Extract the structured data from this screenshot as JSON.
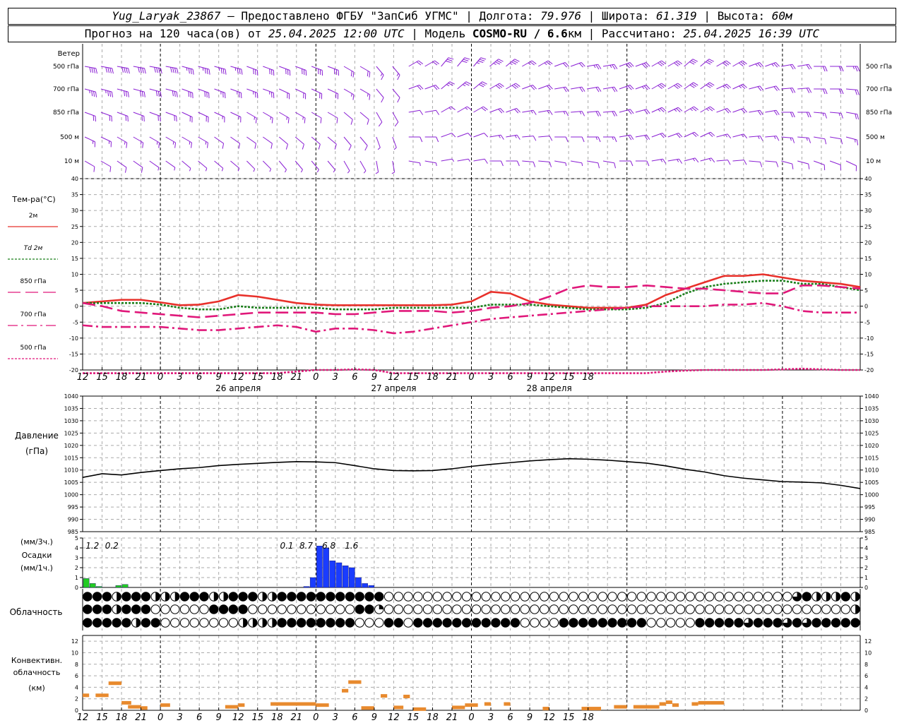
{
  "header": {
    "station": "Yug_Laryak_23867",
    "provider": "— Предоставлено ФГБУ \"ЗапСиб УГМС\"",
    "lon_label": "| Долгота:",
    "lon": "79.976",
    "lat_label": "| Широта:",
    "lat": "61.319",
    "alt_label": "| Высота:",
    "alt": "60м",
    "fc_prefix": "Прогноз на 120 часа(ов) от",
    "fc_time": "25.04.2025 12:00 UTC",
    "model_label": "| Модель",
    "model": "COSMO-RU / 6.6",
    "model_unit": "км",
    "calc_label": "| Рассчитано:",
    "calc_time": "25.04.2025 16:39 UTC"
  },
  "chart_data": [
    {
      "type": "wind-barbs",
      "title": "Ветер",
      "levels": [
        "500 гПа",
        "700 гПа",
        "850 гПа",
        "500 м",
        "10 м"
      ],
      "speeds_ms": [
        [
          20,
          20,
          19,
          18,
          17,
          16,
          15,
          14,
          10,
          7,
          10,
          15,
          18,
          18,
          12,
          10,
          12,
          14,
          15,
          16,
          14,
          12,
          11,
          10,
          12
        ],
        [
          17,
          16,
          15,
          14,
          13,
          12,
          11,
          10,
          8,
          6,
          9,
          12,
          14,
          14,
          10,
          9,
          11,
          13,
          14,
          15,
          13,
          11,
          10,
          9,
          11
        ],
        [
          11,
          10,
          9,
          9,
          8,
          8,
          7,
          6,
          5,
          4,
          6,
          8,
          9,
          10,
          8,
          7,
          9,
          11,
          12,
          12,
          10,
          9,
          9,
          8,
          10
        ],
        [
          8,
          8,
          7,
          7,
          6,
          6,
          5,
          5,
          4,
          3,
          4,
          5,
          6,
          7,
          6,
          5,
          7,
          9,
          10,
          10,
          8,
          7,
          7,
          6,
          8
        ],
        [
          4,
          4,
          3,
          3,
          3,
          3,
          2,
          2,
          2,
          2,
          3,
          3,
          4,
          4,
          4,
          3,
          5,
          6,
          7,
          7,
          6,
          5,
          5,
          4,
          5
        ]
      ],
      "directions_deg": [
        [
          280,
          280,
          280,
          285,
          285,
          290,
          290,
          290,
          300,
          320,
          240,
          220,
          220,
          230,
          240,
          250,
          260,
          250,
          240,
          230,
          240,
          250,
          260,
          270,
          270
        ],
        [
          285,
          285,
          285,
          290,
          290,
          290,
          295,
          295,
          300,
          320,
          250,
          230,
          230,
          240,
          250,
          260,
          260,
          250,
          240,
          235,
          245,
          255,
          265,
          270,
          275
        ],
        [
          290,
          290,
          290,
          295,
          295,
          300,
          300,
          300,
          310,
          330,
          260,
          240,
          240,
          250,
          260,
          265,
          265,
          255,
          245,
          240,
          250,
          260,
          270,
          275,
          280
        ],
        [
          295,
          300,
          300,
          300,
          305,
          305,
          310,
          310,
          320,
          340,
          270,
          250,
          250,
          260,
          265,
          270,
          270,
          260,
          250,
          245,
          255,
          265,
          275,
          280,
          285
        ],
        [
          300,
          305,
          305,
          310,
          310,
          315,
          320,
          320,
          330,
          350,
          280,
          260,
          260,
          270,
          275,
          280,
          280,
          270,
          260,
          255,
          265,
          275,
          285,
          290,
          295
        ]
      ]
    },
    {
      "type": "line",
      "ylabel": "Тем-ра(°C)",
      "ylim": [
        -20,
        40
      ],
      "yticks": [
        "40",
        "35",
        "30",
        "25",
        "20",
        "15",
        "10",
        "5",
        "0",
        "-5",
        "-10",
        "-15",
        "-20"
      ],
      "x_hours": [
        0,
        3,
        6,
        9,
        12,
        15,
        18,
        21,
        24,
        27,
        30,
        33,
        36,
        39,
        42,
        45,
        48,
        51,
        54,
        57,
        60,
        63,
        66,
        69,
        72,
        75,
        78,
        81,
        84,
        87,
        90,
        93,
        96,
        99,
        102,
        105,
        108,
        111,
        114,
        117,
        120
      ],
      "series": [
        {
          "name": "2м",
          "color": "#e8302a",
          "dash": "solid",
          "values": [
            1,
            1.5,
            2,
            2,
            1.2,
            0.3,
            0.5,
            1.5,
            3.5,
            3,
            2,
            1,
            0.5,
            0.3,
            0.3,
            0.3,
            0.3,
            0.3,
            0.3,
            0.5,
            1.5,
            4.5,
            4,
            1.5,
            0.5,
            0,
            -0.5,
            -0.5,
            -0.5,
            0.5,
            3.5,
            5.5,
            7.5,
            9.5,
            9.5,
            10,
            9,
            8,
            7.5,
            7,
            6
          ]
        },
        {
          "name": "Td 2м",
          "color": "#1a7f1a",
          "dash": "dotted",
          "values": [
            1,
            1,
            1,
            1,
            0.5,
            -0.5,
            -1,
            -1,
            0,
            -0.5,
            -0.5,
            -0.5,
            -0.5,
            -1,
            -1,
            -1,
            -0.5,
            -0.5,
            -0.5,
            -0.5,
            -0.5,
            0.5,
            0.5,
            0.5,
            0,
            -0.5,
            -1,
            -1,
            -1,
            -0.5,
            1,
            4,
            6,
            7,
            7.5,
            8,
            8,
            7,
            7,
            6,
            5
          ]
        },
        {
          "name": "850 гПа",
          "color": "#e0187a",
          "dash": "longdash",
          "values": [
            1,
            0,
            -1.5,
            -2,
            -2.5,
            -3,
            -3.5,
            -3,
            -2.5,
            -2,
            -2,
            -2,
            -2,
            -2.5,
            -2.5,
            -2,
            -1.5,
            -1.5,
            -1.5,
            -2,
            -1.5,
            -0.5,
            0,
            1,
            3,
            5.5,
            6.5,
            6,
            6,
            6.5,
            6,
            5.5,
            5.5,
            5,
            4.5,
            4,
            4,
            6.5,
            6.5,
            6,
            5.5
          ]
        },
        {
          "name": "700 гПа",
          "color": "#e0187a",
          "dash": "dashdot",
          "values": [
            -6,
            -6.5,
            -6.5,
            -6.5,
            -6.5,
            -7,
            -7.5,
            -7.5,
            -7,
            -6.5,
            -6,
            -6.5,
            -8,
            -7,
            -7,
            -7.5,
            -8.5,
            -8,
            -7,
            -6,
            -5,
            -4,
            -3.5,
            -3,
            -2.5,
            -2,
            -1.5,
            -1,
            -0.5,
            0,
            0,
            0,
            0,
            0.5,
            0.5,
            1,
            0,
            -1.5,
            -2,
            -2,
            -2
          ]
        },
        {
          "name": "500 гПа",
          "color": "#e0187a",
          "dash": "dotted",
          "values": [
            -21,
            -21,
            -21,
            -21,
            -21,
            -21,
            -21,
            -21,
            -21,
            -21,
            -21,
            -20.5,
            -20,
            -20,
            -19.8,
            -20,
            -21,
            -21,
            -21,
            -21,
            -21,
            -21,
            -21,
            -21,
            -21,
            -21,
            -21,
            -21,
            -21,
            -21,
            -20.5,
            -20.2,
            -20,
            -20,
            -20,
            -20,
            -19.8,
            -19.6,
            -19.8,
            -20,
            -20
          ]
        }
      ]
    },
    {
      "type": "line",
      "ylabel": "Давление",
      "yunit": "(гПа)",
      "ylim": [
        985,
        1040
      ],
      "yticks": [
        "1040",
        "1035",
        "1030",
        "1025",
        "1020",
        "1015",
        "1010",
        "1005",
        "1000",
        "995",
        "990",
        "985"
      ],
      "x_hours": [
        0,
        3,
        6,
        9,
        12,
        15,
        18,
        21,
        24,
        27,
        30,
        33,
        36,
        39,
        42,
        45,
        48,
        51,
        54,
        57,
        60,
        63,
        66,
        69,
        72,
        75,
        78,
        81,
        84,
        87,
        90,
        93,
        96,
        99,
        102,
        105,
        108,
        111,
        114,
        117,
        120
      ],
      "values": [
        1007,
        1008.5,
        1008,
        1009,
        1009.8,
        1010.5,
        1011,
        1011.8,
        1012.3,
        1012.7,
        1013.1,
        1013.4,
        1013.3,
        1013,
        1011.8,
        1010.5,
        1009.8,
        1009.7,
        1009.8,
        1010.5,
        1011.5,
        1012.3,
        1013,
        1013.7,
        1014.2,
        1014.6,
        1014.4,
        1014,
        1013.4,
        1012.8,
        1011.7,
        1010.3,
        1009.2,
        1007.7,
        1006.7,
        1006,
        1005.3,
        1005.1,
        1004.8,
        1003.8,
        1002.5
      ],
      "color": "#000000"
    },
    {
      "type": "bar",
      "ylabel": "Осадки",
      "yunit_top": "(мм/3ч.)",
      "yunit_bottom": "(мм/1ч.)",
      "ylim": [
        0,
        5
      ],
      "yticks": [
        "5",
        "4",
        "3",
        "2",
        "1",
        "0"
      ],
      "annotations": [
        "1.2",
        "0.2",
        "0.1",
        "8.7",
        "6.8",
        "1.6"
      ],
      "series": [
        {
          "name": "liquid",
          "color": "#22cc22",
          "hours": [
            0,
            1,
            2,
            3,
            4,
            5,
            6
          ],
          "values": [
            0.9,
            0.4,
            0.1,
            0,
            0,
            0.2,
            0.3
          ]
        },
        {
          "name": "snow",
          "color": "#1a3cff",
          "hours": [
            34,
            35,
            36,
            37,
            38,
            39,
            40,
            41,
            42,
            43,
            44
          ],
          "values": [
            0.1,
            1,
            4.2,
            4,
            2.7,
            2.5,
            2.2,
            2,
            1,
            0.4,
            0.2
          ]
        }
      ]
    },
    {
      "type": "symbols",
      "ylabel": "Облачность",
      "rows": [
        "ffpfhhffffhhhhfftffehhfffffhhhfffffffffffffffffeeeeeeeeeeeeeeeeeeeeeeeeeeeeeeepeeeeeeeeeeeeeeeeeeeeeeeeeeeeeeeeeepfehhhhffhp",
        "ffqfheffffeeeeeeeeefffffffeeeeeeeeeeeeeeeeefffqeeeeeeeeeeeeeeeeeeeeeeeeeeeeeeeeeeeeeeeeeeeeeeeeeeeeeeeeeeeeeeeeeeeeeeeeeeeehe",
        "fffffffhffffeeeeeeeeeeeehhhhhhhffffhfffffffeeeeepffpefffffffffffffffffeeeeeeeffffffffffffffeeeeeeeeffffffffpffffffpffpfffffffff"
      ]
    },
    {
      "type": "bar",
      "ylabel": "Конвективн.",
      "ylabel2": "облачность",
      "yunit": "(км)",
      "ylim": [
        0,
        13
      ],
      "yticks": [
        "12",
        "10",
        "8",
        "6",
        "4",
        "2",
        "0"
      ],
      "color": "#e88a2e",
      "segments": [
        {
          "h0": 0,
          "h1": 1,
          "v": 2.6
        },
        {
          "h0": 2,
          "h1": 4,
          "v": 2.6
        },
        {
          "h0": 4,
          "h1": 6,
          "v": 4.7
        },
        {
          "h0": 6,
          "h1": 7.5,
          "v": 1.3
        },
        {
          "h0": 7,
          "h1": 9,
          "v": 0.6
        },
        {
          "h0": 9,
          "h1": 10,
          "v": 0.4
        },
        {
          "h0": 12,
          "h1": 13.5,
          "v": 0.9
        },
        {
          "h0": 22,
          "h1": 24,
          "v": 0.6
        },
        {
          "h0": 24,
          "h1": 25,
          "v": 0.9
        },
        {
          "h0": 29,
          "h1": 36,
          "v": 1.1
        },
        {
          "h0": 36,
          "h1": 38,
          "v": 0.9
        },
        {
          "h0": 40,
          "h1": 41,
          "v": 3.4
        },
        {
          "h0": 41,
          "h1": 43,
          "v": 4.9
        },
        {
          "h0": 43,
          "h1": 45,
          "v": 0.4
        },
        {
          "h0": 46,
          "h1": 47,
          "v": 2.5
        },
        {
          "h0": 48,
          "h1": 49.5,
          "v": 0.5
        },
        {
          "h0": 49.5,
          "h1": 50.5,
          "v": 2.4
        },
        {
          "h0": 51,
          "h1": 53,
          "v": 0.2
        },
        {
          "h0": 57,
          "h1": 59,
          "v": 0.5
        },
        {
          "h0": 59,
          "h1": 61,
          "v": 0.9
        },
        {
          "h0": 62,
          "h1": 63,
          "v": 1.1
        },
        {
          "h0": 65,
          "h1": 66,
          "v": 1.1
        },
        {
          "h0": 71,
          "h1": 72,
          "v": 0.3
        },
        {
          "h0": 77,
          "h1": 80,
          "v": 0.3
        },
        {
          "h0": 82,
          "h1": 84,
          "v": 0.6
        },
        {
          "h0": 85,
          "h1": 89,
          "v": 0.6
        },
        {
          "h0": 89,
          "h1": 90,
          "v": 1.1
        },
        {
          "h0": 90,
          "h1": 91,
          "v": 1.4
        },
        {
          "h0": 91,
          "h1": 92,
          "v": 0.9
        },
        {
          "h0": 94,
          "h1": 95,
          "v": 1.1
        },
        {
          "h0": 95,
          "h1": 97,
          "v": 1.3
        },
        {
          "h0": 97,
          "h1": 99,
          "v": 1.3
        }
      ]
    }
  ],
  "time_axis": {
    "hours": [
      "12",
      "15",
      "18",
      "21",
      "0",
      "3",
      "6",
      "9",
      "12",
      "15",
      "18",
      "21",
      "0",
      "3",
      "6",
      "9",
      "12",
      "15",
      "18",
      "21",
      "0",
      "3",
      "6",
      "9",
      "12",
      "15",
      "18"
    ],
    "dates": [
      "26 апреля",
      "27 апреля",
      "28 апреля"
    ]
  }
}
